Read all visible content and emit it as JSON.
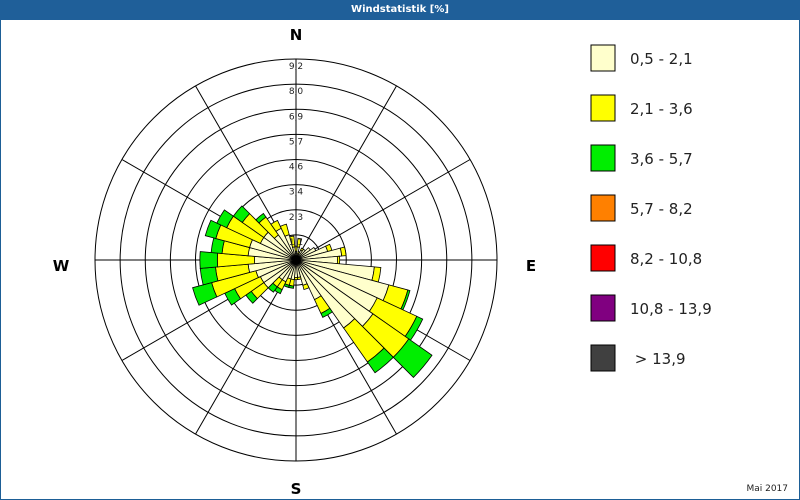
{
  "title": "Windstatistik [%]",
  "footer": "Mai 2017",
  "chart_data": {
    "type": "wind-rose",
    "directions": 36,
    "direction_labels": {
      "N": "N",
      "E": "E",
      "S": "S",
      "W": "W"
    },
    "radial_ticks": [
      "1,1",
      "2,3",
      "3,4",
      "4,6",
      "5,7",
      "6,9",
      "8,0",
      "9,2"
    ],
    "radial_max": 9.2,
    "legend": [
      {
        "label": "0,5 - 2,1",
        "color": "#ffffcc"
      },
      {
        "label": "2,1 - 3,6",
        "color": "#ffff00"
      },
      {
        "label": "3,6 - 5,7",
        "color": "#00ee00"
      },
      {
        "label": "5,7 - 8,2",
        "color": "#ff8000"
      },
      {
        "label": "8,2 - 10,8",
        "color": "#ff0000"
      },
      {
        "label": "10,8 - 13,9",
        "color": "#800080"
      },
      {
        "label": "> 13,9",
        "color": "#404040"
      }
    ],
    "sectors": [
      {
        "dir": 0,
        "values": [
          0.4,
          0.2,
          0,
          0,
          0,
          0,
          0
        ]
      },
      {
        "dir": 10,
        "values": [
          0.6,
          0.4,
          0,
          0,
          0,
          0,
          0
        ]
      },
      {
        "dir": 20,
        "values": [
          0.3,
          0.1,
          0,
          0,
          0,
          0,
          0
        ]
      },
      {
        "dir": 30,
        "values": [
          0.5,
          0.1,
          0,
          0,
          0,
          0,
          0
        ]
      },
      {
        "dir": 40,
        "values": [
          0.6,
          0,
          0,
          0,
          0,
          0,
          0
        ]
      },
      {
        "dir": 50,
        "values": [
          0.8,
          0,
          0,
          0,
          0,
          0,
          0
        ]
      },
      {
        "dir": 60,
        "values": [
          1.0,
          0,
          0,
          0,
          0,
          0,
          0
        ]
      },
      {
        "dir": 70,
        "values": [
          1.5,
          0.2,
          0,
          0,
          0,
          0,
          0
        ]
      },
      {
        "dir": 80,
        "values": [
          2.1,
          0.2,
          0,
          0,
          0,
          0,
          0
        ]
      },
      {
        "dir": 90,
        "values": [
          1.9,
          0.1,
          0,
          0,
          0,
          0,
          0
        ]
      },
      {
        "dir": 100,
        "values": [
          3.6,
          0.3,
          0,
          0,
          0,
          0,
          0
        ]
      },
      {
        "dir": 110,
        "values": [
          4.4,
          0.9,
          0.1,
          0,
          0,
          0,
          0
        ]
      },
      {
        "dir": 120,
        "values": [
          4.1,
          2.0,
          0.3,
          0,
          0,
          0,
          0
        ]
      },
      {
        "dir": 130,
        "values": [
          4.3,
          2.0,
          1.3,
          0,
          0,
          0,
          0
        ]
      },
      {
        "dir": 140,
        "values": [
          3.8,
          1.9,
          0.6,
          0,
          0,
          0,
          0
        ]
      },
      {
        "dir": 150,
        "values": [
          2.0,
          0.7,
          0.2,
          0,
          0,
          0,
          0
        ]
      },
      {
        "dir": 160,
        "values": [
          1.2,
          0.2,
          0,
          0,
          0,
          0,
          0
        ]
      },
      {
        "dir": 170,
        "values": [
          0.8,
          0.1,
          0,
          0,
          0,
          0,
          0
        ]
      },
      {
        "dir": 180,
        "values": [
          0.8,
          0.1,
          0,
          0,
          0,
          0,
          0
        ]
      },
      {
        "dir": 190,
        "values": [
          0.9,
          0.3,
          0.1,
          0,
          0,
          0,
          0
        ]
      },
      {
        "dir": 200,
        "values": [
          0.9,
          0.3,
          0.1,
          0,
          0,
          0,
          0
        ]
      },
      {
        "dir": 210,
        "values": [
          1.1,
          0.4,
          0.2,
          0,
          0,
          0,
          0
        ]
      },
      {
        "dir": 220,
        "values": [
          1.1,
          0.4,
          0.3,
          0,
          0,
          0,
          0
        ]
      },
      {
        "dir": 230,
        "values": [
          1.8,
          0.7,
          0.3,
          0,
          0,
          0,
          0
        ]
      },
      {
        "dir": 240,
        "values": [
          1.8,
          1.3,
          0.5,
          0,
          0,
          0,
          0
        ]
      },
      {
        "dir": 250,
        "values": [
          1.9,
          2.1,
          0.9,
          0,
          0,
          0,
          0
        ]
      },
      {
        "dir": 260,
        "values": [
          2.2,
          1.5,
          0.7,
          0,
          0,
          0,
          0
        ]
      },
      {
        "dir": 270,
        "values": [
          1.9,
          1.7,
          0.8,
          0,
          0,
          0,
          0
        ]
      },
      {
        "dir": 280,
        "values": [
          2.2,
          1.2,
          0.5,
          0,
          0,
          0,
          0
        ]
      },
      {
        "dir": 290,
        "values": [
          2.2,
          1.6,
          0.5,
          0,
          0,
          0,
          0
        ]
      },
      {
        "dir": 300,
        "values": [
          1.8,
          1.7,
          0.5,
          0,
          0,
          0,
          0
        ]
      },
      {
        "dir": 310,
        "values": [
          1.8,
          1.2,
          0.5,
          0,
          0,
          0,
          0
        ]
      },
      {
        "dir": 320,
        "values": [
          1.4,
          1.0,
          0.2,
          0,
          0,
          0,
          0
        ]
      },
      {
        "dir": 330,
        "values": [
          1.6,
          0.4,
          0,
          0,
          0,
          0,
          0
        ]
      },
      {
        "dir": 340,
        "values": [
          1.2,
          0.5,
          0,
          0,
          0,
          0,
          0
        ]
      },
      {
        "dir": 350,
        "values": [
          0.6,
          0.5,
          0,
          0,
          0,
          0,
          0
        ]
      }
    ]
  }
}
